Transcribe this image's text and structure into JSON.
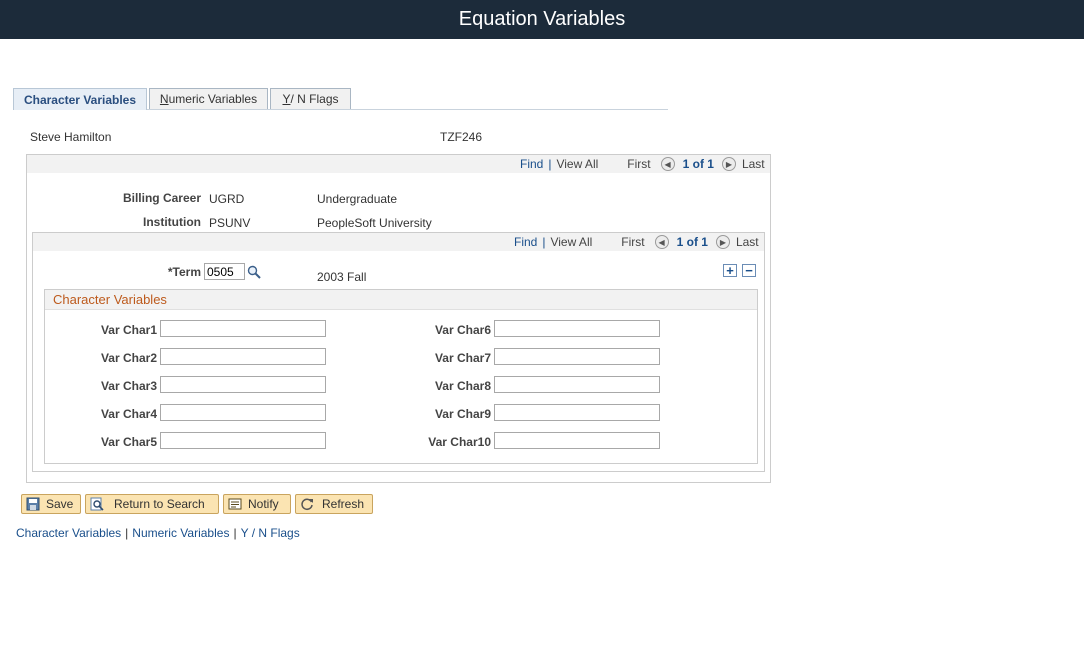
{
  "header": {
    "title": "Equation Variables"
  },
  "tabs": [
    {
      "pre": "",
      "ul": "",
      "post": "Character Variables"
    },
    {
      "pre": "",
      "ul": "N",
      "post": "umeric Variables"
    },
    {
      "pre": "",
      "ul": "Y",
      "post": " / N Flags"
    }
  ],
  "person": {
    "name": "Steve Hamilton",
    "id": "TZF246"
  },
  "outer_nav": {
    "find": "Find",
    "view_all": "View All",
    "first": "First",
    "count": "1 of 1",
    "last": "Last"
  },
  "billing": {
    "label": "Billing Career",
    "code": "UGRD",
    "desc": "Undergraduate"
  },
  "institution": {
    "label": "Institution",
    "code": "PSUNV",
    "desc": "PeopleSoft University"
  },
  "inner_nav": {
    "find": "Find",
    "view_all": "View All",
    "first": "First",
    "count": "1 of 1",
    "last": "Last"
  },
  "term": {
    "label": "*Term",
    "value": "0505",
    "desc": "2003 Fall"
  },
  "section": {
    "title": "Character Variables"
  },
  "vars_left": [
    {
      "label": "Var Char1",
      "value": ""
    },
    {
      "label": "Var Char2",
      "value": ""
    },
    {
      "label": "Var Char3",
      "value": ""
    },
    {
      "label": "Var Char4",
      "value": ""
    },
    {
      "label": "Var Char5",
      "value": ""
    }
  ],
  "vars_right": [
    {
      "label": "Var Char6",
      "value": ""
    },
    {
      "label": "Var Char7",
      "value": ""
    },
    {
      "label": "Var Char8",
      "value": ""
    },
    {
      "label": "Var Char9",
      "value": ""
    },
    {
      "label": "Var Char10",
      "value": ""
    }
  ],
  "buttons": {
    "save": "Save",
    "return": "Return to Search",
    "notify": "Notify",
    "refresh": "Refresh"
  },
  "footer": {
    "link1": "Character Variables",
    "link2": "Numeric Variables",
    "link3": "Y / N Flags",
    "sep": "|"
  },
  "colors": {
    "titlebar": "#1c2b3a",
    "link": "#1a4f8b",
    "section_title": "#bd5a1c",
    "button_bg": "#fbe4b2"
  },
  "icons": {
    "term_lookup": "magnifier-icon",
    "add_row": "plus-icon",
    "delete_row": "minus-icon",
    "nav_prev": "arrow-left-icon",
    "nav_next": "arrow-right-icon"
  }
}
